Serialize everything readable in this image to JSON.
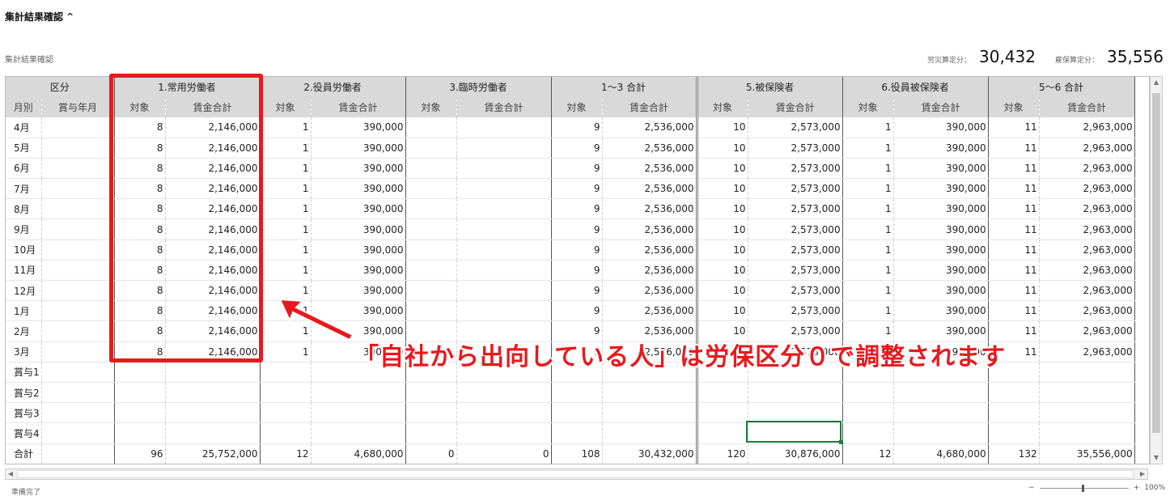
{
  "section": {
    "title": "集計結果確認",
    "sub_title": "集計結果確認"
  },
  "summary": {
    "rousai_label": "労災算定分：",
    "rousai_value": "30,432",
    "koyou_label": "雇保算定分：",
    "koyou_value": "35,556"
  },
  "grid": {
    "groups": [
      "区分",
      "1.常用労働者",
      "2.役員労働者",
      "3.臨時労働者",
      "1～3 合計",
      "5.被保険者",
      "6.役員被保険者",
      "5～6 合計"
    ],
    "sub_headers": [
      "月別",
      "賞与年月",
      "対象",
      "賃金合計",
      "対象",
      "賃金合計",
      "対象",
      "賃金合計",
      "対象",
      "賃金合計",
      "対象",
      "賃金合計",
      "対象",
      "賃金合計",
      "対象",
      "賃金合計"
    ],
    "rows": [
      [
        "4月",
        "",
        "8",
        "2,146,000",
        "1",
        "390,000",
        "",
        "",
        "9",
        "2,536,000",
        "10",
        "2,573,000",
        "1",
        "390,000",
        "11",
        "2,963,000"
      ],
      [
        "5月",
        "",
        "8",
        "2,146,000",
        "1",
        "390,000",
        "",
        "",
        "9",
        "2,536,000",
        "10",
        "2,573,000",
        "1",
        "390,000",
        "11",
        "2,963,000"
      ],
      [
        "6月",
        "",
        "8",
        "2,146,000",
        "1",
        "390,000",
        "",
        "",
        "9",
        "2,536,000",
        "10",
        "2,573,000",
        "1",
        "390,000",
        "11",
        "2,963,000"
      ],
      [
        "7月",
        "",
        "8",
        "2,146,000",
        "1",
        "390,000",
        "",
        "",
        "9",
        "2,536,000",
        "10",
        "2,573,000",
        "1",
        "390,000",
        "11",
        "2,963,000"
      ],
      [
        "8月",
        "",
        "8",
        "2,146,000",
        "1",
        "390,000",
        "",
        "",
        "9",
        "2,536,000",
        "10",
        "2,573,000",
        "1",
        "390,000",
        "11",
        "2,963,000"
      ],
      [
        "9月",
        "",
        "8",
        "2,146,000",
        "1",
        "390,000",
        "",
        "",
        "9",
        "2,536,000",
        "10",
        "2,573,000",
        "1",
        "390,000",
        "11",
        "2,963,000"
      ],
      [
        "10月",
        "",
        "8",
        "2,146,000",
        "1",
        "390,000",
        "",
        "",
        "9",
        "2,536,000",
        "10",
        "2,573,000",
        "1",
        "390,000",
        "11",
        "2,963,000"
      ],
      [
        "11月",
        "",
        "8",
        "2,146,000",
        "1",
        "390,000",
        "",
        "",
        "9",
        "2,536,000",
        "10",
        "2,573,000",
        "1",
        "390,000",
        "11",
        "2,963,000"
      ],
      [
        "12月",
        "",
        "8",
        "2,146,000",
        "1",
        "390,000",
        "",
        "",
        "9",
        "2,536,000",
        "10",
        "2,573,000",
        "1",
        "390,000",
        "11",
        "2,963,000"
      ],
      [
        "1月",
        "",
        "8",
        "2,146,000",
        "1",
        "390,000",
        "",
        "",
        "9",
        "2,536,000",
        "10",
        "2,573,000",
        "1",
        "390,000",
        "11",
        "2,963,000"
      ],
      [
        "2月",
        "",
        "8",
        "2,146,000",
        "1",
        "390,000",
        "",
        "",
        "9",
        "2,536,000",
        "10",
        "2,573,000",
        "1",
        "390,000",
        "11",
        "2,963,000"
      ],
      [
        "3月",
        "",
        "8",
        "2,146,000",
        "1",
        "390,000",
        "",
        "",
        "9",
        "2,536,000",
        "10",
        "2,573,000",
        "1",
        "390,000",
        "11",
        "2,963,000"
      ],
      [
        "賞与1",
        "",
        "",
        "",
        "",
        "",
        "",
        "",
        "",
        "",
        "",
        "",
        "",
        "",
        "",
        ""
      ],
      [
        "賞与2",
        "",
        "",
        "",
        "",
        "",
        "",
        "",
        "",
        "",
        "",
        "",
        "",
        "",
        "",
        ""
      ],
      [
        "賞与3",
        "",
        "",
        "",
        "",
        "",
        "",
        "",
        "",
        "",
        "",
        "",
        "",
        "",
        "",
        ""
      ],
      [
        "賞与4",
        "",
        "",
        "",
        "",
        "",
        "",
        "",
        "",
        "",
        "",
        "",
        "",
        "",
        "",
        ""
      ],
      [
        "合計",
        "",
        "96",
        "25,752,000",
        "12",
        "4,680,000",
        "0",
        "0",
        "108",
        "30,432,000",
        "120",
        "30,876,000",
        "12",
        "4,680,000",
        "132",
        "35,556,000"
      ]
    ]
  },
  "annotation": "「自社から出向している人」は労保区分０で調整されます",
  "status": {
    "text": "準備完了",
    "zoom_minus": "−",
    "zoom_plus": "+",
    "zoom_level": "100%"
  }
}
